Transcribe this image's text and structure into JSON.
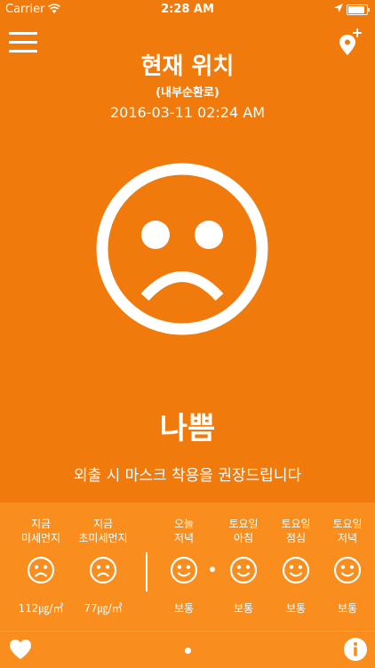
{
  "status_bar": {
    "carrier": "Carrier",
    "time": "2:28 AM"
  },
  "header": {
    "title": "현재 위치",
    "subtitle": "(내부순환로)",
    "datetime": "2016-03-11 02:24 AM"
  },
  "main": {
    "status": "나쁨",
    "advice": "외출 시 마스크 착용을 권장드립니다"
  },
  "forecast": {
    "current": [
      {
        "label": "지금\n미세먼지",
        "value": "112㎍/㎥",
        "icon": "sad-face-icon"
      },
      {
        "label": "지금\n초미세먼지",
        "value": "77㎍/㎥",
        "icon": "sad-face-icon"
      }
    ],
    "upcoming": [
      {
        "label": "오늘\n저녁",
        "value": "보통",
        "icon": "smile-face-icon"
      },
      {
        "label": "토요일\n아침",
        "value": "보통",
        "icon": "smile-face-icon"
      },
      {
        "label": "토요일\n점심",
        "value": "보통",
        "icon": "smile-face-icon"
      },
      {
        "label": "토요일\n저녁",
        "value": "보통",
        "icon": "smile-face-icon"
      }
    ]
  },
  "colors": {
    "background": "#f07a0c",
    "panel": "#f98e1e",
    "foreground": "#ffffff"
  }
}
